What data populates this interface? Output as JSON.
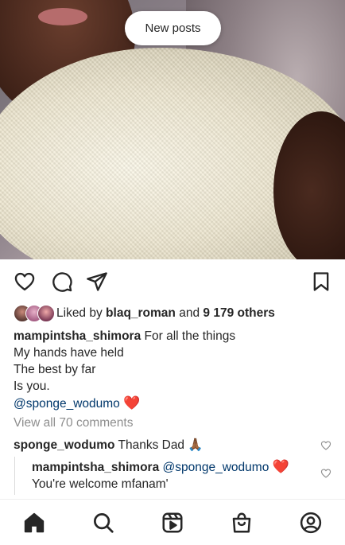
{
  "new_posts_label": "New posts",
  "likes": {
    "prefix": "Liked by",
    "user": "blaq_roman",
    "connector": "and",
    "others": "9 179 others"
  },
  "caption": {
    "username": "mampintsha_shimora",
    "lines": [
      "For all the things",
      "My hands have held",
      "The best by far",
      "Is you."
    ],
    "mention": "@sponge_wodumo",
    "emoji": "❤️"
  },
  "view_all_comments": "View all 70 comments",
  "comments": [
    {
      "username": "sponge_wodumo",
      "text": "Thanks Dad 🙏🏾"
    },
    {
      "username": "mampintsha_shimora",
      "mention": "@sponge_wodumo",
      "emoji": "❤️",
      "text": "You're welcome mfanam'"
    }
  ],
  "icons": {
    "like": "heart-icon",
    "comment": "comment-icon",
    "share": "send-icon",
    "save": "bookmark-icon",
    "tabs": [
      "home-icon",
      "search-icon",
      "reels-icon",
      "shop-icon",
      "profile-icon"
    ]
  }
}
